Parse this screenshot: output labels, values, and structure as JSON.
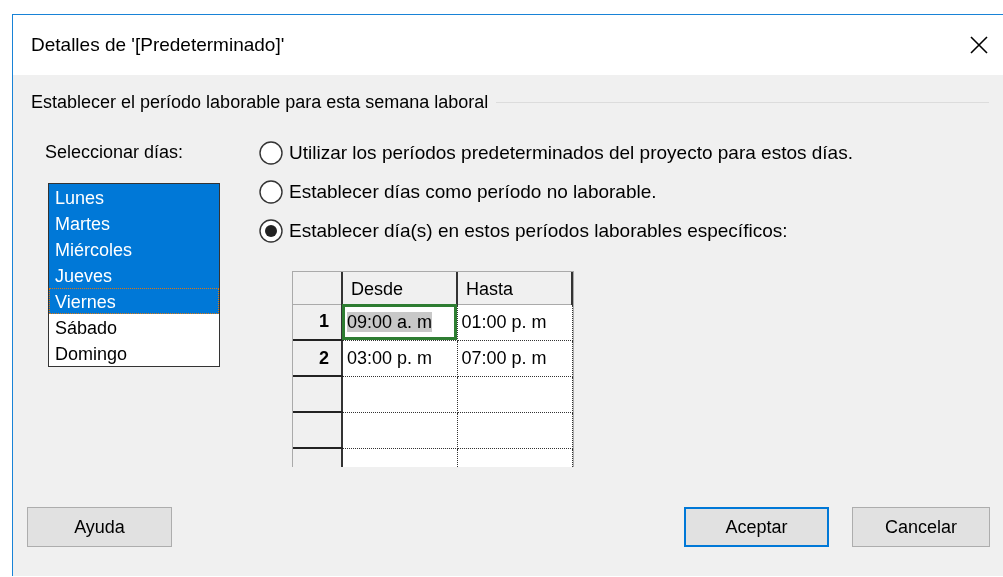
{
  "window": {
    "title": "Detalles de '[Predeterminado]'"
  },
  "group": {
    "title": "Establecer el período laborable para esta semana laboral"
  },
  "day_list": {
    "label": "Seleccionar días:",
    "items": [
      {
        "label": "Lunes",
        "selected": true,
        "focused": false
      },
      {
        "label": "Martes",
        "selected": true,
        "focused": false
      },
      {
        "label": "Miércoles",
        "selected": true,
        "focused": false
      },
      {
        "label": "Jueves",
        "selected": true,
        "focused": false
      },
      {
        "label": "Viernes",
        "selected": true,
        "focused": true
      },
      {
        "label": "Sábado",
        "selected": false,
        "focused": false
      },
      {
        "label": "Domingo",
        "selected": false,
        "focused": false
      }
    ]
  },
  "options": [
    {
      "label": "Utilizar los períodos predeterminados del proyecto para estos días.",
      "selected": false
    },
    {
      "label": "Establecer días como período no laborable.",
      "selected": false
    },
    {
      "label": "Establecer día(s) en estos períodos laborables específicos:",
      "selected": true
    }
  ],
  "periods": {
    "columns": [
      "Desde",
      "Hasta"
    ],
    "rows": [
      {
        "number": "1",
        "cells": [
          {
            "text": "09:00 a. m",
            "selected": true
          },
          {
            "text": "01:00 p. m",
            "selected": false
          }
        ]
      },
      {
        "number": "2",
        "cells": [
          {
            "text": "03:00 p. m",
            "selected": false
          },
          {
            "text": "07:00 p. m",
            "selected": false
          }
        ]
      }
    ]
  },
  "buttons": [
    {
      "label": "Ayuda",
      "kind": "help",
      "default": false
    },
    {
      "label": "Aceptar",
      "kind": "dialog",
      "default": true
    },
    {
      "label": "Cancelar",
      "kind": "dialog",
      "default": false
    }
  ]
}
